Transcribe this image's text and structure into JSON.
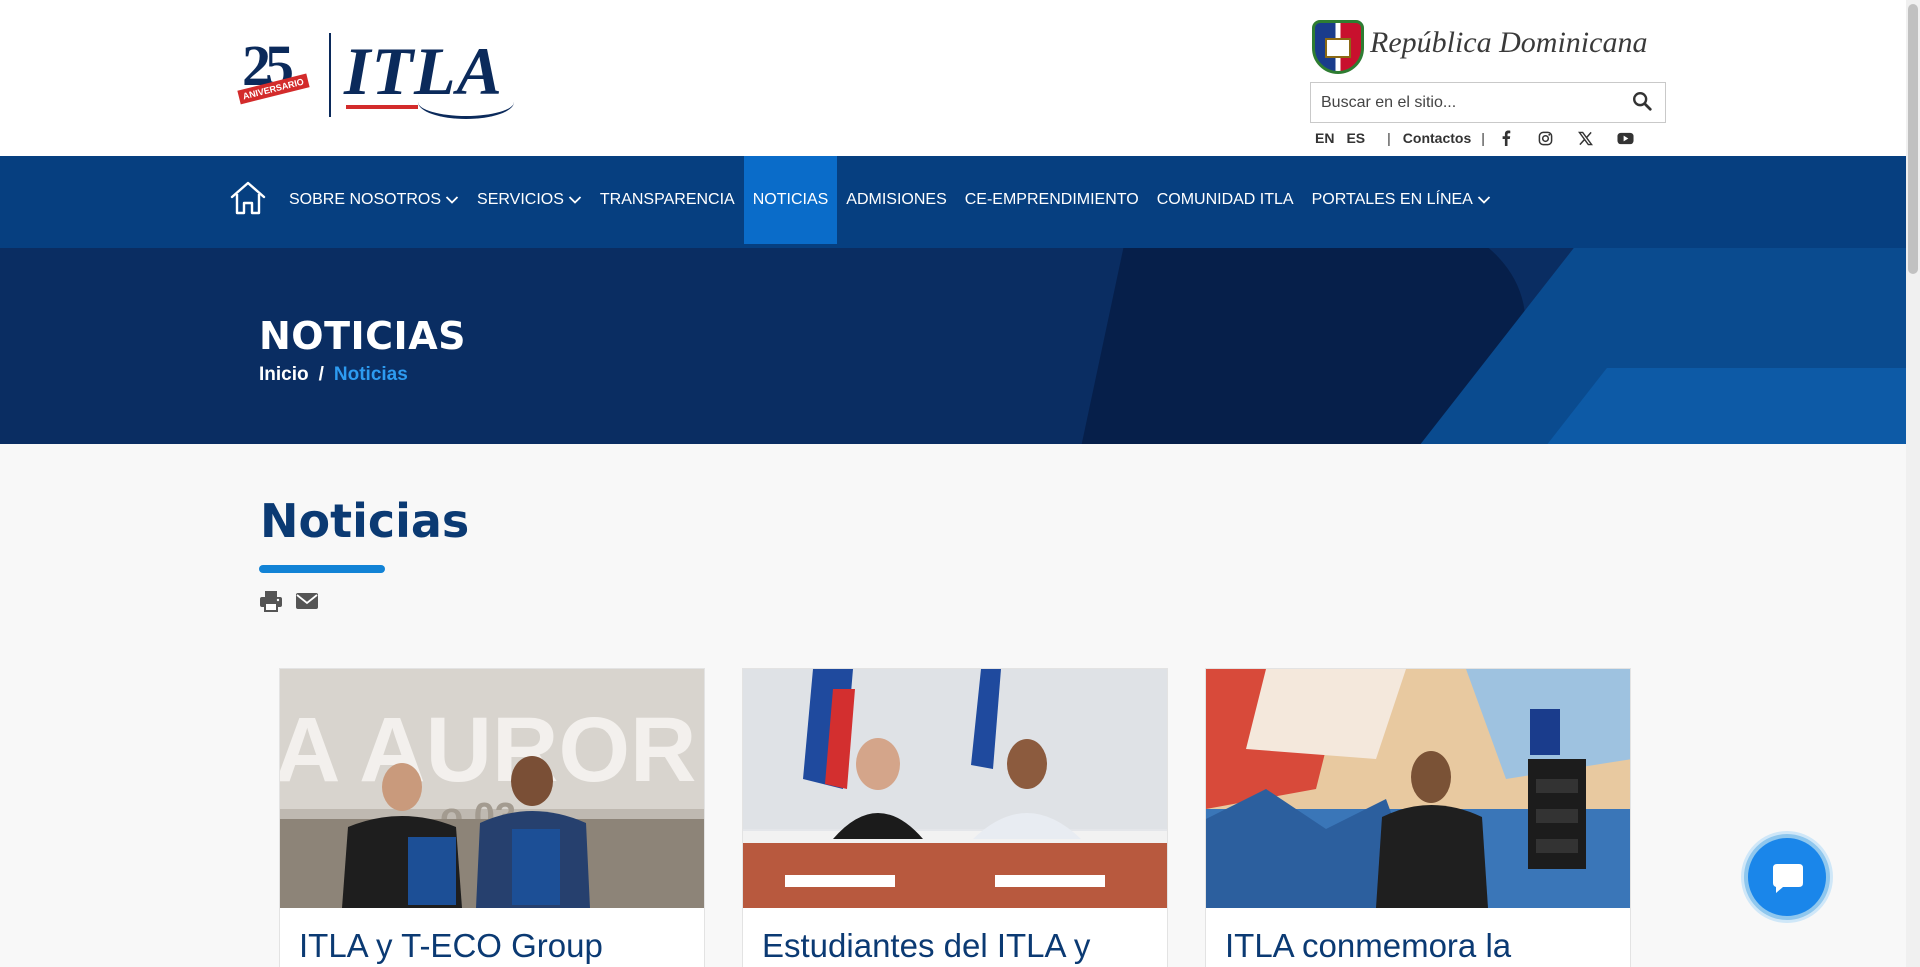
{
  "header": {
    "logo_number": "25",
    "logo_ribbon": "ANIVERSARIO",
    "logo_text": "ITLA",
    "gov_name": "República Dominicana",
    "search_placeholder": "Buscar en el sitio...",
    "lang_en": "EN",
    "lang_es": "ES",
    "separator": "|",
    "contacts": "Contactos"
  },
  "social_icons": [
    "facebook-icon",
    "instagram-icon",
    "x-icon",
    "youtube-icon"
  ],
  "nav": {
    "items": [
      {
        "label": "SOBRE NOSOTROS",
        "dropdown": true,
        "active": false
      },
      {
        "label": "SERVICIOS",
        "dropdown": true,
        "active": false
      },
      {
        "label": "TRANSPARENCIA",
        "dropdown": false,
        "active": false
      },
      {
        "label": "NOTICIAS",
        "dropdown": false,
        "active": true
      },
      {
        "label": "ADMISIONES",
        "dropdown": false,
        "active": false
      },
      {
        "label": "CE-EMPRENDIMIENTO",
        "dropdown": false,
        "active": false
      },
      {
        "label": "COMUNIDAD ITLA",
        "dropdown": false,
        "active": false
      },
      {
        "label": "PORTALES EN LÍNEA",
        "dropdown": true,
        "active": false
      }
    ]
  },
  "banner": {
    "title": "NOTICIAS",
    "crumb_home": "Inicio",
    "crumb_sep": "/",
    "crumb_current": "Noticias"
  },
  "page": {
    "title": "Noticias"
  },
  "cards": [
    {
      "title": "ITLA y T-ECO Group"
    },
    {
      "title": "Estudiantes del ITLA y"
    },
    {
      "title": "ITLA conmemora la"
    }
  ],
  "colors": {
    "nav_bg": "#063f80",
    "nav_active": "#0a6cc9",
    "banner_bg": "#0a2d62",
    "title_color": "#0b3a73",
    "accent": "#1283d6"
  }
}
